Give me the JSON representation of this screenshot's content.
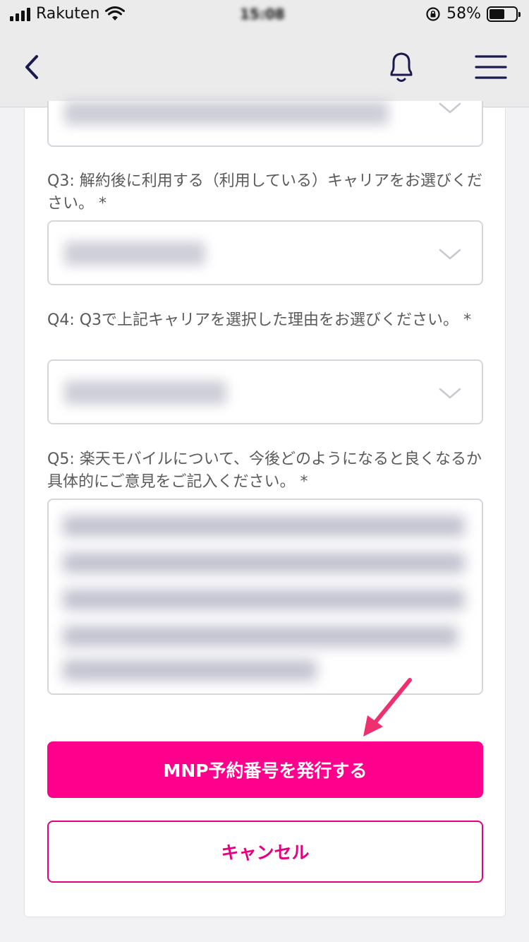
{
  "status_bar": {
    "carrier": "Rakuten",
    "time": "15:08",
    "battery_percent": "58%",
    "battery_level": 0.58
  },
  "nav": {
    "icons": [
      "chevron-left-icon",
      "bell-icon",
      "hamburger-menu-icon"
    ]
  },
  "form": {
    "q3_label": "Q3: 解約後に利用する（利用している）キャリアをお選びください。 *",
    "q4_label": "Q4: Q3で上記キャリアを選択した理由をお選びください。 *",
    "q5_label": "Q5: 楽天モバイルについて、今後どのようになると良くなるか具体的にご意見をご記入ください。 *"
  },
  "actions": {
    "issue_label": "MNP予約番号を発行する",
    "cancel_label": "キャンセル"
  },
  "colors": {
    "brand_pink": "#ff008c",
    "cancel_pink": "#e6007e",
    "nav_icon": "#1a1a4e",
    "annotation_arrow": "#f0306e"
  }
}
